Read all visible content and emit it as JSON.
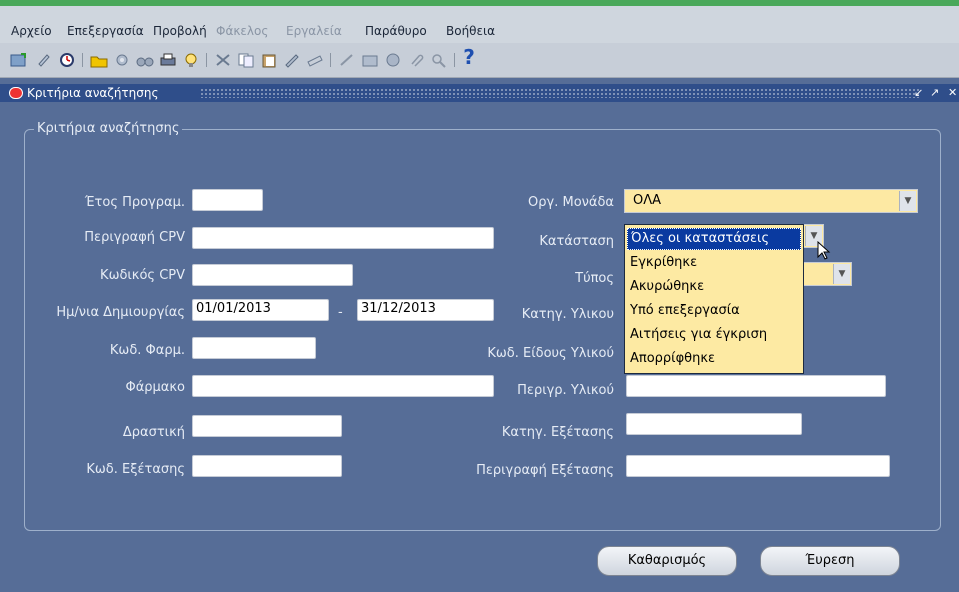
{
  "menu": [
    {
      "label": "Αρχείο",
      "enabled": true
    },
    {
      "label": "Επεξεργασία",
      "enabled": true
    },
    {
      "label": "Προβολή",
      "enabled": true
    },
    {
      "label": "Φάκελος",
      "enabled": false
    },
    {
      "label": "Εργαλεία",
      "enabled": false
    },
    {
      "label": "Παράθυρο",
      "enabled": true
    },
    {
      "label": "Βοήθεια",
      "enabled": true
    }
  ],
  "toolbar": {
    "help_glyph": "?"
  },
  "window": {
    "title": "Κριτήρια αναζήτησης"
  },
  "form": {
    "group_title": "Κριτήρια αναζήτησης",
    "labels": {
      "year": "Έτος Προγραμ.",
      "cpv_desc": "Περιγραφή CPV",
      "cpv_code": "Κωδικός CPV",
      "created_date": "Ημ/νια Δημιουργίας",
      "date_sep": "-",
      "drug_code": "Κωδ. Φαρμ.",
      "drug": "Φάρμακο",
      "active": "Δραστική",
      "exam_code": "Κωδ. Εξέτασης",
      "org_unit": "Οργ. Μονάδα",
      "status": "Κατάσταση",
      "type": "Τύπος",
      "material_cat": "Κατηγ. Υλικου",
      "material_kind": "Κωδ. Είδους Υλικού",
      "material_desc": "Περιγρ. Υλικού",
      "exam_cat": "Κατηγ. Εξέτασης",
      "exam_desc": "Περιγραφή Εξέτασης"
    },
    "values": {
      "year": "",
      "cpv_desc": "",
      "cpv_code": "",
      "date_from": "01/01/2013",
      "date_to": "31/12/2013",
      "drug_code": "",
      "drug": "",
      "active": "",
      "exam_code": "",
      "org_unit": "ΟΛΑ",
      "material_desc": "",
      "exam_cat": "",
      "exam_desc": ""
    },
    "status_options": [
      "Όλες οι καταστάσεις",
      "Εγκρίθηκε",
      "Ακυρώθηκε",
      "Υπό επεξεργασία",
      "Αιτήσεις για έγκριση",
      "Απορρίφθηκε"
    ],
    "status_selected_index": 0
  },
  "buttons": {
    "clear": "Καθαρισμός",
    "find": "Έυρεση"
  }
}
